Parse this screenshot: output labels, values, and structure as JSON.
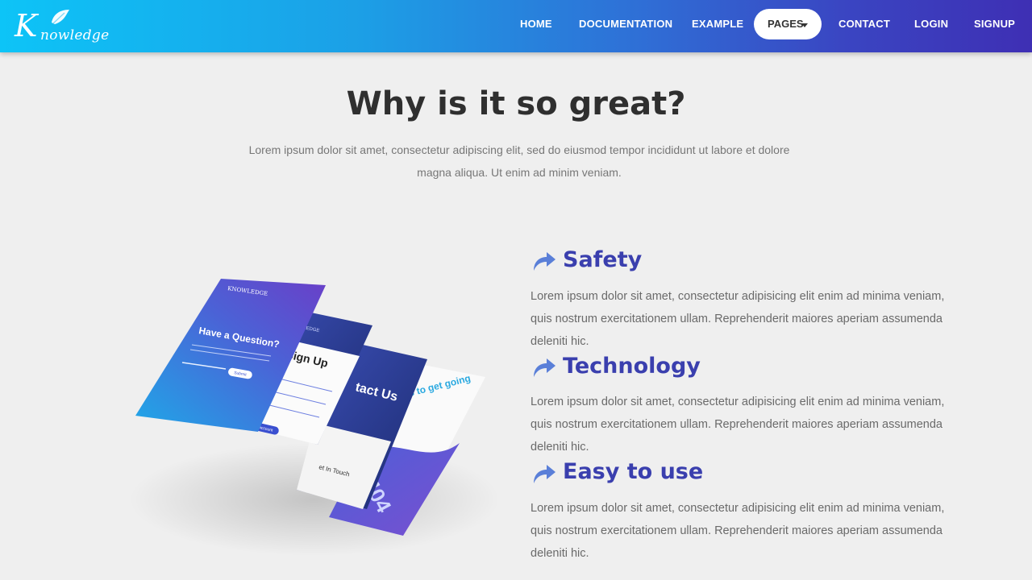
{
  "navbar": {
    "logo_first": "K",
    "logo_rest": "nowledge",
    "items": [
      {
        "label": "HOME"
      },
      {
        "label": "DOCUMENTATION"
      },
      {
        "label": "EXAMPLE"
      },
      {
        "label": "PAGES"
      },
      {
        "label": "CONTACT"
      },
      {
        "label": "LOGIN"
      },
      {
        "label": "SIGNUP"
      }
    ]
  },
  "section": {
    "title": "Why is it so great?",
    "intro": "Lorem ipsum dolor sit amet, consectetur adipiscing elit, sed do eiusmod tempor incididunt ut labore et dolore magna aliqua. Ut enim ad minim veniam."
  },
  "features": [
    {
      "icon": "share-arrow-icon",
      "title": "Safety",
      "text": "Lorem ipsum dolor sit amet, consectetur adipisicing elit enim ad minima veniam, quis nostrum exercitationem ullam. Reprehenderit maiores aperiam assumenda deleniti hic."
    },
    {
      "icon": "share-arrow-icon",
      "title": "Technology",
      "text": "Lorem ipsum dolor sit amet, consectetur adipisicing elit enim ad minima veniam, quis nostrum exercitationem ullam. Reprehenderit maiores aperiam assumenda deleniti hic."
    },
    {
      "icon": "share-arrow-icon",
      "title": "Easy to use",
      "text": "Lorem ipsum dolor sit amet, consectetur adipisicing elit enim ad minima veniam, quis nostrum exercitationem ullam. Reprehenderit maiores aperiam assumenda deleniti hic."
    }
  ],
  "mockup": {
    "screen1_brand": "KNOWLEDGE",
    "screen1_heading": "Have a Question?",
    "screen1_button": "Submit",
    "screen2_brand": "LEDGE",
    "screen2_heading": "Sign Up",
    "screen2_button": "Create account",
    "screen3_heading": "tact Us",
    "screen3_footer": "et In Touch",
    "screen4_heading": "s to get going",
    "screen4_number": "404"
  },
  "colors": {
    "nav_gradient_start": "#0dc4f7",
    "nav_gradient_end": "#3e2fb4",
    "feature_title": "#3a3fae",
    "background": "#efefef"
  }
}
